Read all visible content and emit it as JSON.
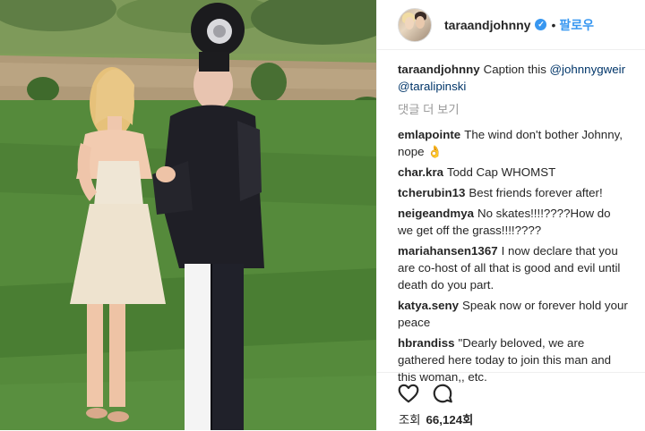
{
  "post": {
    "username": "taraandjohnny",
    "verified_icon": "verified-badge-icon",
    "separator": "•",
    "follow_label": "팔로우"
  },
  "caption": {
    "user": "taraandjohnny",
    "text": "Caption this ",
    "mention1": "@johnnygweir",
    "mention2": "@taralipinski"
  },
  "more_comments_label": "댓글 더 보기",
  "comments": [
    {
      "user": "emlapointe",
      "text": "The wind don't bother Johnny, nope 👌"
    },
    {
      "user": "char.kra",
      "text": "Todd Cap WHOMST"
    },
    {
      "user": "tcherubin13",
      "text": "Best friends forever after!"
    },
    {
      "user": "neigeandmya",
      "text": "No skates!!!!????How do we get off the grass!!!!????"
    },
    {
      "user": "mariahansen1367",
      "text": "I now declare that you are co-host of all that is good and evil until death do you part."
    },
    {
      "user": "katya.seny",
      "text": "Speak now or forever hold your peace"
    },
    {
      "user": "hbrandiss",
      "text": "\"Dearly beloved, we are gathered here today to join this man and this woman,, etc."
    }
  ],
  "stats": {
    "views_label": "조회",
    "views_count": "66,124회"
  },
  "icons": {
    "like": "heart-icon",
    "comment": "comment-bubble-icon"
  },
  "colors": {
    "accent": "#3897f0",
    "mention": "#003569",
    "muted": "#999999",
    "text": "#262626"
  }
}
